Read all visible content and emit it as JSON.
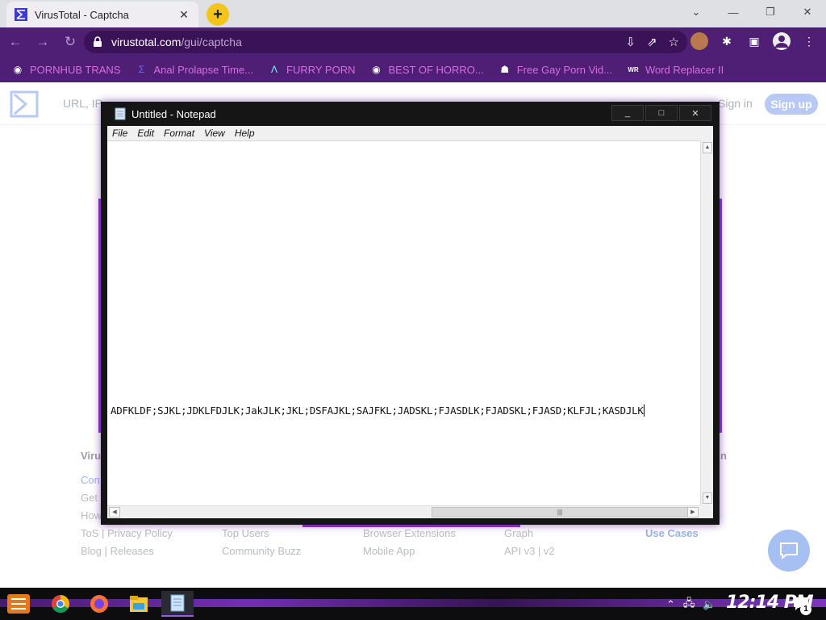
{
  "browser": {
    "tab": {
      "title": "VirusTotal - Captcha",
      "close": "✕"
    },
    "new_tab": "+",
    "window_controls": {
      "minimize": "—",
      "restore": "❐",
      "close": "✕"
    },
    "nav": {
      "back": "←",
      "forward": "→",
      "reload": "↻"
    },
    "url_host": "virustotal.com",
    "url_path": "/gui/captcha",
    "omnibox_icons": {
      "install": "⇩",
      "share": "⇗",
      "bookmark": "☆"
    },
    "bookmarks": [
      {
        "label": "PORNHUB TRANS",
        "icon": "globe-icon"
      },
      {
        "label": "Anal Prolapse Time...",
        "icon": "virustotal-icon"
      },
      {
        "label": "FURRY PORN",
        "icon": "lambda-icon"
      },
      {
        "label": "BEST OF HORRO...",
        "icon": "globe-icon"
      },
      {
        "label": "Free Gay Porn Vid...",
        "icon": "site-icon"
      },
      {
        "label": "Word Replacer II",
        "icon": "wr-icon"
      }
    ],
    "accent": "#4e1f74"
  },
  "vt_page": {
    "search_placeholder": "URL, IP",
    "sign_in": "Sign in",
    "sign_up": "Sign up",
    "footer_cols": [
      [
        "Viru",
        "Con",
        "Get",
        "How",
        "ToS | Privacy Policy",
        "Blog | Releases"
      ],
      [
        "Top Users",
        "Community Buzz"
      ],
      [
        "Browser Extensions",
        "Mobile App"
      ],
      [
        "Graph",
        "API v3 | v2"
      ],
      [
        "n",
        "Use Cases"
      ]
    ]
  },
  "notepad": {
    "title": "Untitled - Notepad",
    "controls": {
      "minimize": "_",
      "maximize": "□",
      "close": "✕"
    },
    "menu": [
      "File",
      "Edit",
      "Format",
      "View",
      "Help"
    ],
    "content": "ADFKLDF;SJKL;JDKLFDJLK;JakJLK;JKL;DSFAJKL;SAJFKL;JADSKL;FJASDLK;FJADSKL;FJASD;KLFJL;KASDJLK"
  },
  "taskbar": {
    "clock": "12:14 PM",
    "notification_count": "1",
    "apps": [
      "start-icon",
      "chrome-icon",
      "firefox-icon",
      "file-explorer-icon",
      "notepad-icon"
    ]
  }
}
